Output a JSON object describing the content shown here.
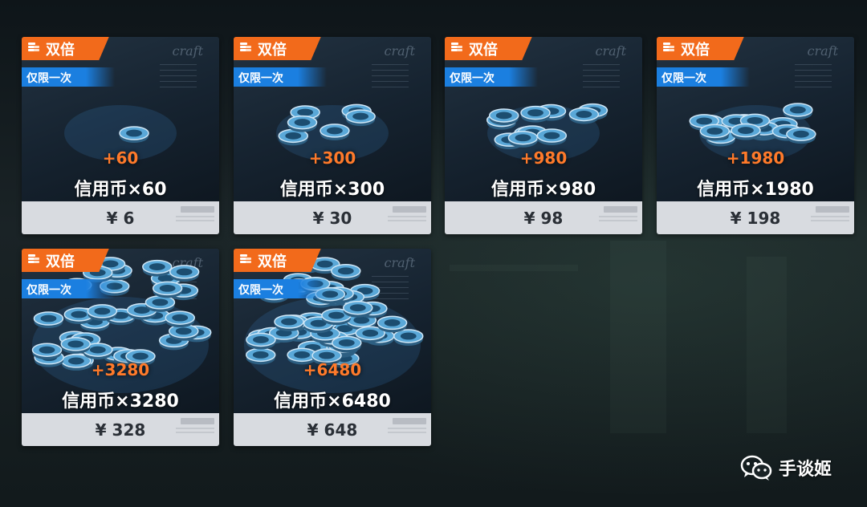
{
  "badges": {
    "double_label": "双倍",
    "once_label": "仅限一次"
  },
  "script_mark": "craft",
  "packs": [
    {
      "bonus": "+60",
      "title": "信用币×60",
      "price": "¥ 6"
    },
    {
      "bonus": "+300",
      "title": "信用币×300",
      "price": "¥ 30"
    },
    {
      "bonus": "+980",
      "title": "信用币×980",
      "price": "¥ 98"
    },
    {
      "bonus": "+1980",
      "title": "信用币×1980",
      "price": "¥ 198"
    },
    {
      "bonus": "+3280",
      "title": "信用币×3280",
      "price": "¥ 328"
    },
    {
      "bonus": "+6480",
      "title": "信用币×6480",
      "price": "¥ 648"
    }
  ],
  "watermark": {
    "label": "手谈姬"
  },
  "colors": {
    "double_badge": "#f26a1b",
    "once_badge": "#1b7fe0",
    "bonus_text": "#ff7a2a",
    "coin": "#5aa8d8"
  }
}
